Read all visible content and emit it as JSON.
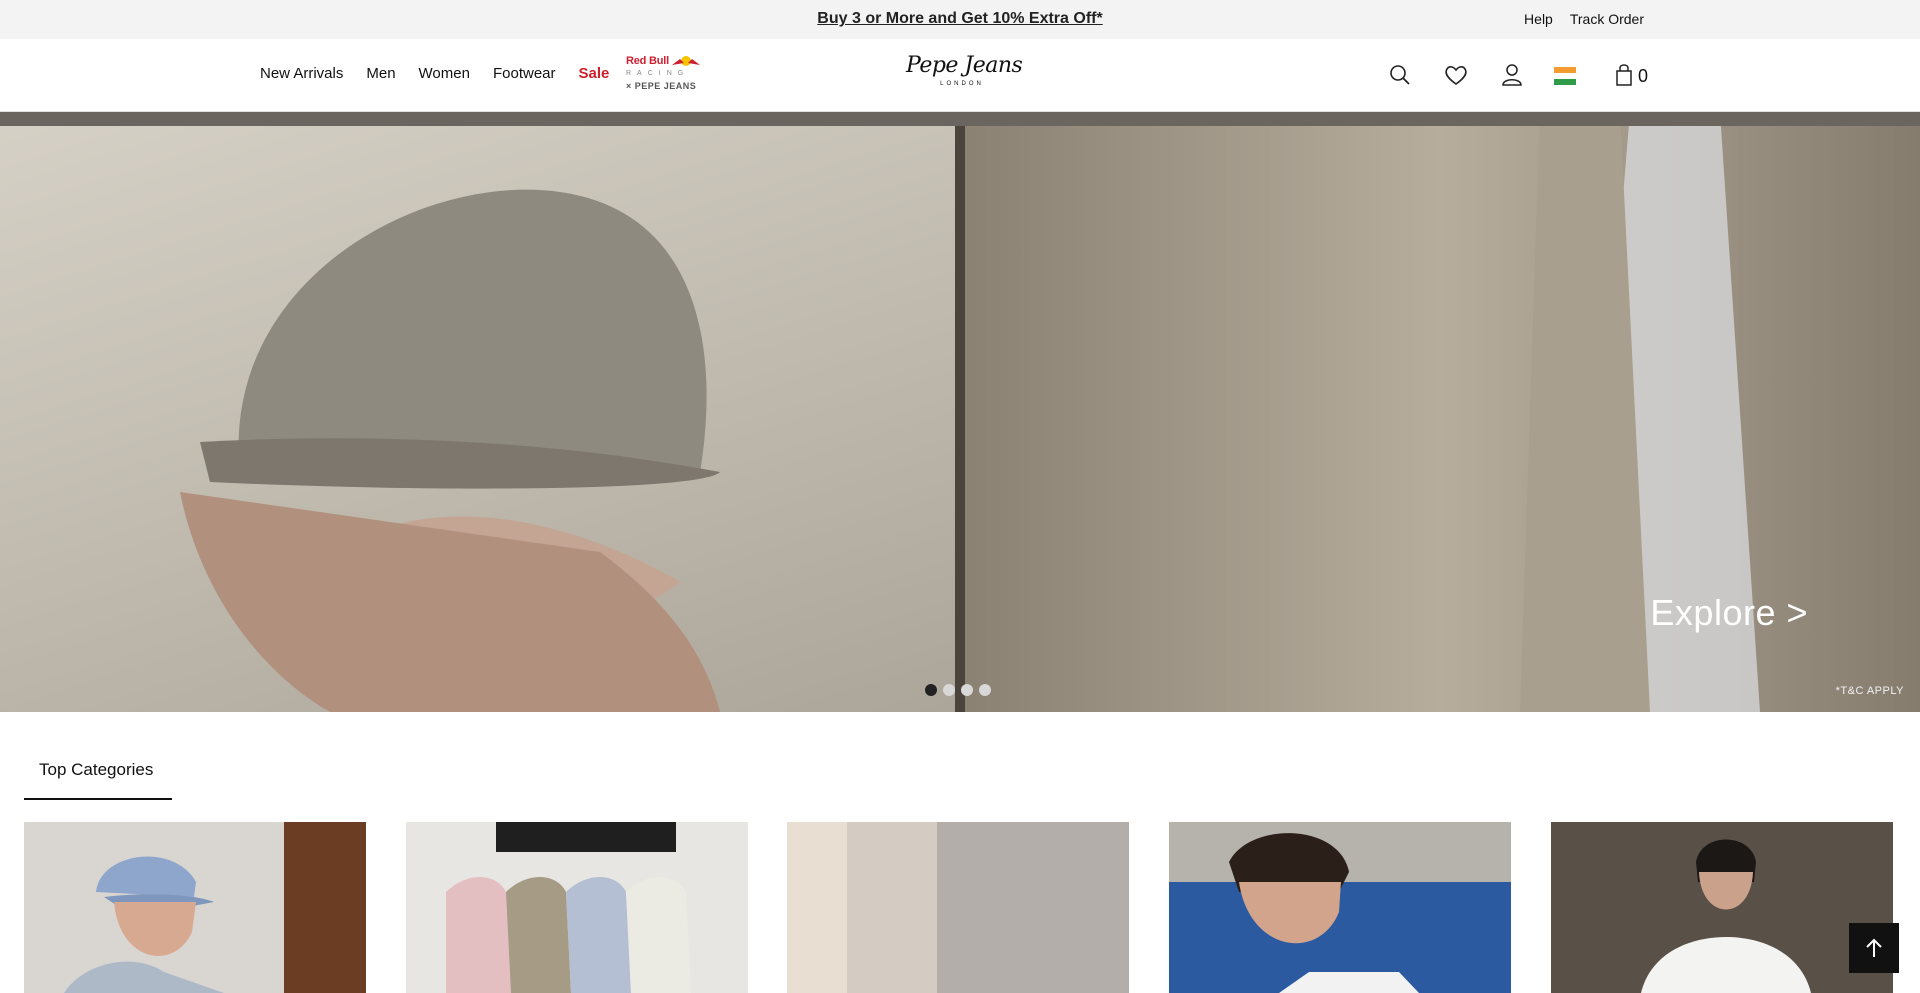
{
  "announcement": {
    "promo": "Buy 3 or More and Get 10% Extra Off*",
    "links": [
      "Help",
      "Track Order"
    ]
  },
  "nav": {
    "items": [
      "New Arrivals",
      "Men",
      "Women",
      "Footwear",
      "Sale"
    ],
    "collab": {
      "brand": "Red Bull",
      "line1": "RACING",
      "line2": "× PEPE JEANS"
    }
  },
  "brand": {
    "name": "Pepe Jeans",
    "tagline": "LONDON"
  },
  "header_icons": [
    "search-icon",
    "heart-icon",
    "user-icon",
    "india-flag-icon",
    "bag-icon"
  ],
  "cart": {
    "count": "0"
  },
  "hero": {
    "cta": "Explore >",
    "disclaimer": "*T&C APPLY",
    "slides": 4,
    "active_slide": 1
  },
  "categories": {
    "tab": "Top Categories"
  },
  "colors": {
    "sale": "#d01f2c",
    "topbar": "#f3f3f3",
    "dark": "#111111"
  }
}
